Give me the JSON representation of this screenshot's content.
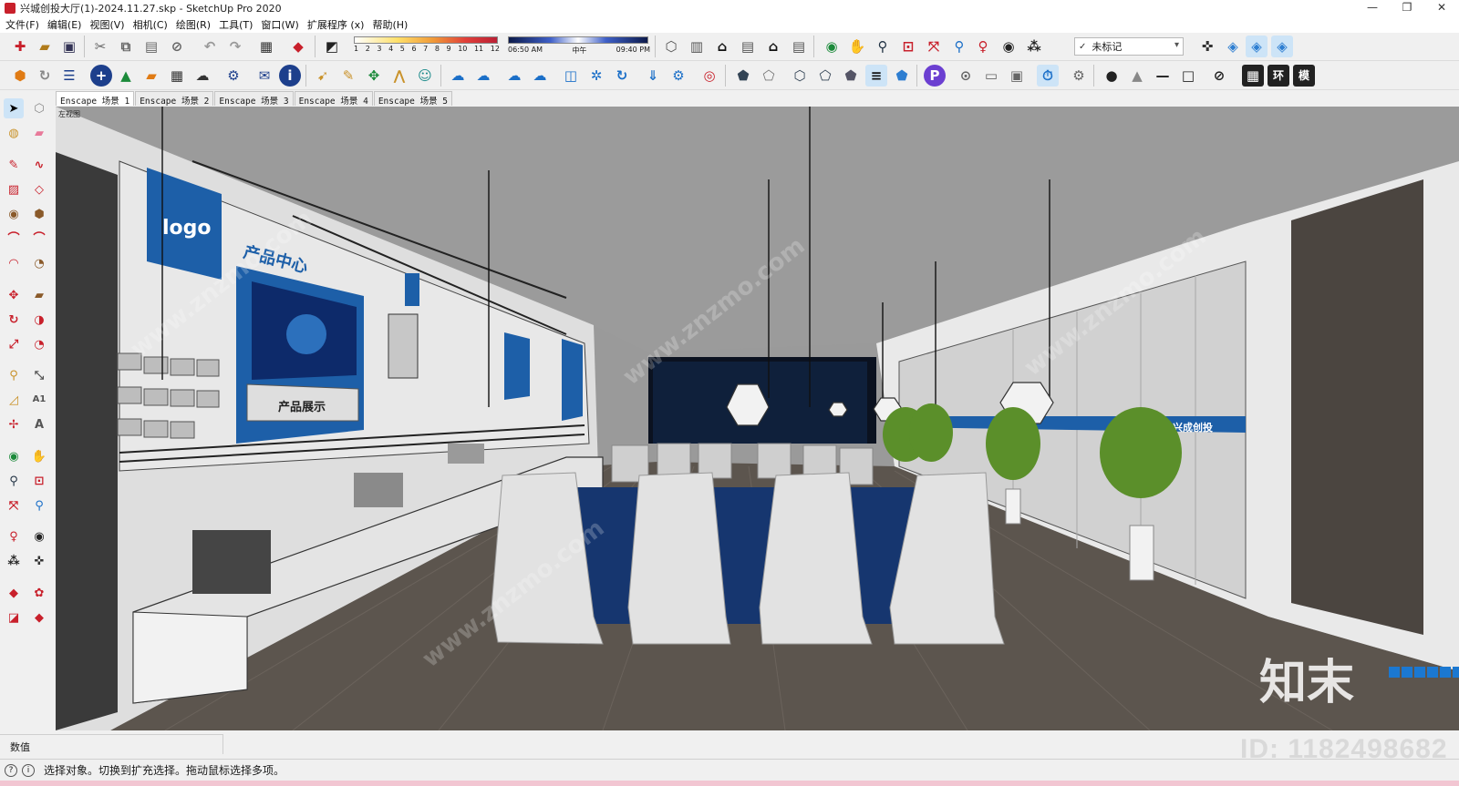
{
  "window": {
    "title": "兴城创投大厅(1)-2024.11.27.skp - SketchUp Pro 2020",
    "controls": [
      "—",
      "❐",
      "✕"
    ]
  },
  "menu": [
    "文件(F)",
    "编辑(E)",
    "视图(V)",
    "相机(C)",
    "绘图(R)",
    "工具(T)",
    "窗口(W)",
    "扩展程序 (x)",
    "帮助(H)"
  ],
  "shadow_months": [
    "1",
    "2",
    "3",
    "4",
    "5",
    "6",
    "7",
    "8",
    "9",
    "10",
    "11",
    "12"
  ],
  "time_labels": {
    "start": "06:50 AM",
    "mid": "中午",
    "end": "09:40 PM"
  },
  "tag_select": {
    "value": "未标记"
  },
  "scene_tabs": [
    "Enscape 场景 1",
    "Enscape 场景 2",
    "Enscape 场景 3",
    "Enscape 场景 4",
    "Enscape 场景 5"
  ],
  "viewport": {
    "view_label": "左视图",
    "logo_text": "logo",
    "wall_title": "产品中心",
    "wall_caption": "产品展示",
    "glass_brand": "兴成创投",
    "brand_overlay": "知末",
    "watermark": "www.znzmo.com"
  },
  "measure": {
    "label": "数值"
  },
  "status": {
    "message": "选择对象。切换到扩充选择。拖动鼠标选择多项。"
  },
  "id_overlay": "ID: 1182498682",
  "colors": {
    "accent_blue": "#1d5fa8",
    "floor": "#5a534c",
    "wall": "#d8d8d8"
  }
}
